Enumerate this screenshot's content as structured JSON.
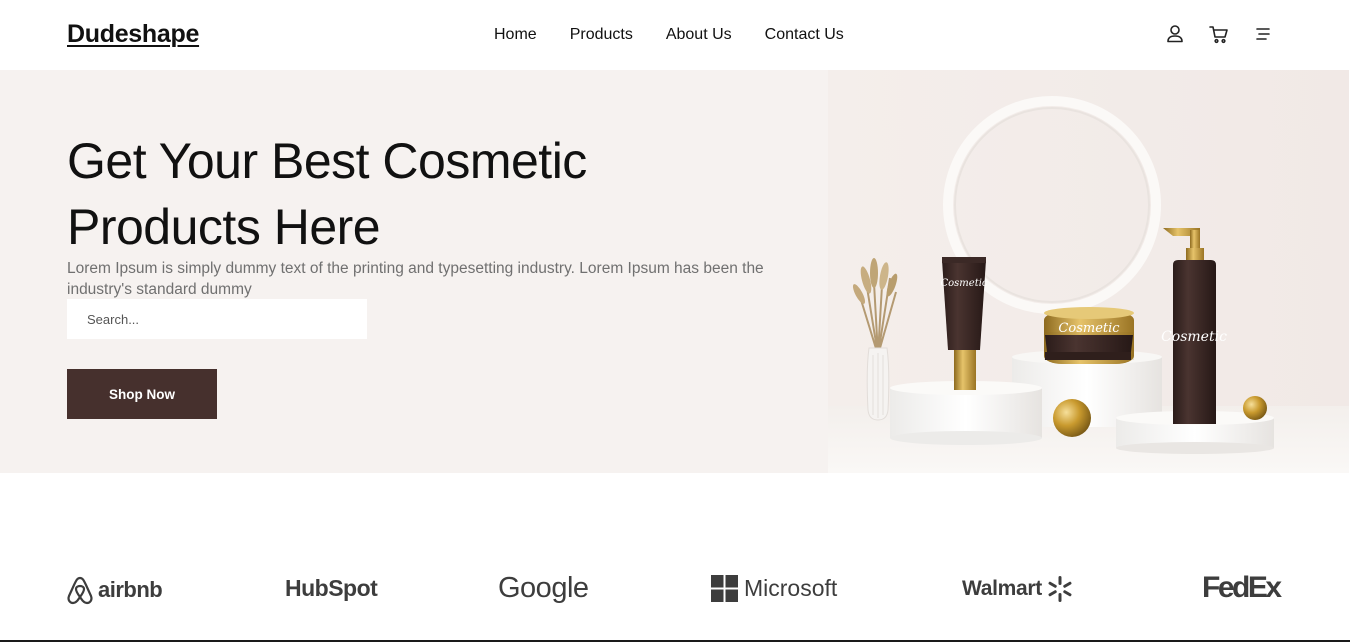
{
  "header": {
    "logo": "Dudeshape",
    "nav": [
      "Home",
      "Products",
      "About Us",
      "Contact Us"
    ],
    "icons": [
      "user-icon",
      "cart-icon",
      "menu-icon"
    ]
  },
  "hero": {
    "title_line1": "Get Your Best Cosmetic",
    "title_line2": "Products Here",
    "description": "Lorem Ipsum is simply dummy text of the printing and typesetting industry. Lorem Ipsum has been the industry's standard dummy",
    "search_placeholder": "Search...",
    "cta_label": "Shop Now",
    "product_labels": {
      "tube": "Cosmetic",
      "jar": "Cosmetic",
      "pump": "Cosmetic"
    }
  },
  "brands": [
    {
      "name": "airbnb"
    },
    {
      "name": "HubSpot"
    },
    {
      "name": "Google"
    },
    {
      "name": "Microsoft"
    },
    {
      "name": "Walmart"
    },
    {
      "name": "FedEx"
    }
  ],
  "colors": {
    "hero_bg": "#f6f2f0",
    "button_bg": "#46302d",
    "brand_gray": "#3d3d3d",
    "product_brown": "#3a2825",
    "gold": "#c9a038"
  }
}
